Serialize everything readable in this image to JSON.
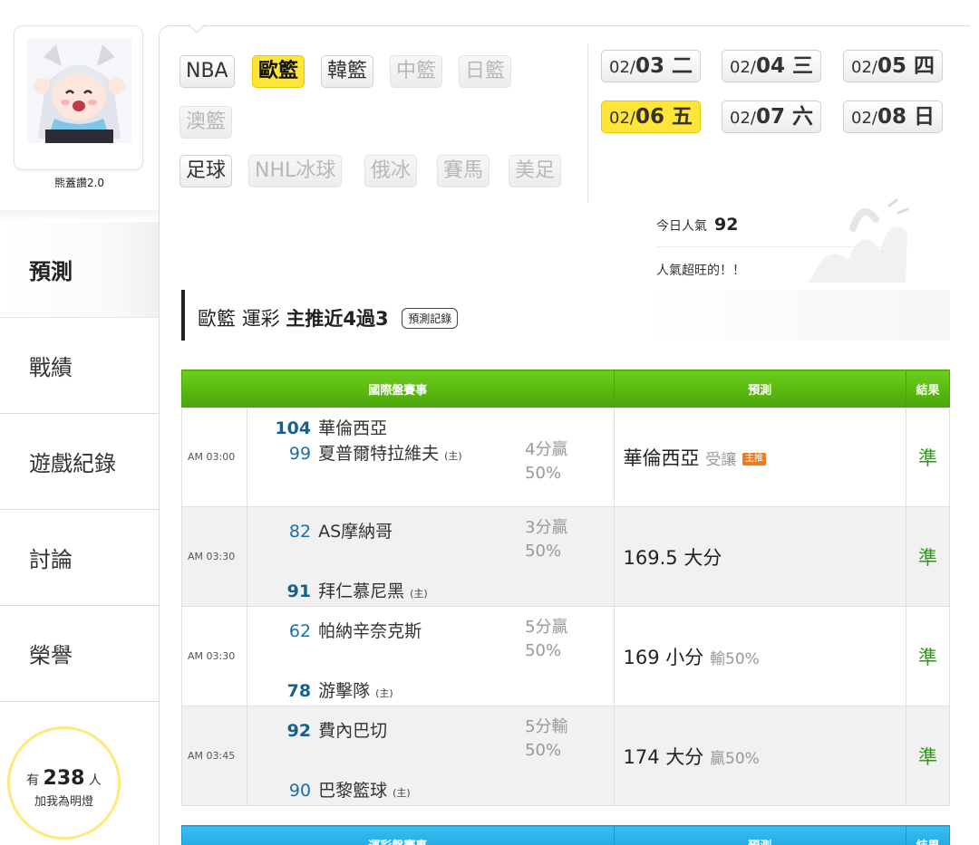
{
  "user": {
    "name": "熊蓋讚2.0"
  },
  "nav": [
    {
      "label": "預測",
      "active": true
    },
    {
      "label": "戰績"
    },
    {
      "label": "遊戲紀錄"
    },
    {
      "label": "討論"
    },
    {
      "label": "榮譽"
    }
  ],
  "fans": {
    "prefix": "有",
    "count": "238",
    "suffix": "人",
    "sub": "加我為明燈"
  },
  "leagues": {
    "row1": [
      "NBA",
      "歐籃",
      "韓籃",
      "中籃",
      "日籃"
    ],
    "row2": [
      "澳籃"
    ],
    "row3": [
      "足球",
      "NHL冰球",
      "俄冰",
      "賽馬",
      "美足"
    ]
  },
  "dates": [
    {
      "mo": "02/",
      "dy": "03 二"
    },
    {
      "mo": "02/",
      "dy": "04 三"
    },
    {
      "mo": "02/",
      "dy": "05 四"
    },
    {
      "mo": "02/",
      "dy": "06 五",
      "active": true
    },
    {
      "mo": "02/",
      "dy": "07 六"
    },
    {
      "mo": "02/",
      "dy": "08 日"
    }
  ],
  "popularity": {
    "label": "今日人氣",
    "value": "92",
    "comment": "人氣超旺的！！"
  },
  "section": {
    "league": "歐籃",
    "type": "運彩",
    "record": "主推近4過3",
    "button": "預測記錄"
  },
  "table": {
    "headers": [
      "國際盤賽事",
      "預測",
      "結果"
    ],
    "home_mark": "(主)",
    "rows": [
      {
        "time": "AM 03:00",
        "away_score": "104",
        "away": "華倫西亞",
        "home_score": "99",
        "home": "夏普爾特拉維夫",
        "odds1": "4分贏",
        "odds2": "50%",
        "pred": "華倫西亞",
        "pred_note": "受讓",
        "badge": "主推",
        "result": "準"
      },
      {
        "time": "AM 03:30",
        "away_score": "82",
        "away": "AS摩納哥",
        "home_score": "91",
        "home": "拜仁慕尼黑",
        "odds1": "3分贏",
        "odds2": "50%",
        "pred": "169.5 大分",
        "pred_note": "",
        "result": "準"
      },
      {
        "time": "AM 03:30",
        "away_score": "62",
        "away": "帕納辛奈克斯",
        "home_score": "78",
        "home": "游擊隊",
        "odds1": "5分贏",
        "odds2": "50%",
        "pred": "169 小分",
        "pred_note": "輸50%",
        "result": "準"
      },
      {
        "time": "AM 03:45",
        "away_score": "92",
        "away": "費內巴切",
        "home_score": "90",
        "home": "巴黎籃球",
        "odds1": "5分輸",
        "odds2": "50%",
        "pred": "174 大分",
        "pred_note": "贏50%",
        "result": "準"
      }
    ]
  },
  "table2": {
    "headers": [
      "運彩盤賽事",
      "預測",
      "結果"
    ]
  }
}
